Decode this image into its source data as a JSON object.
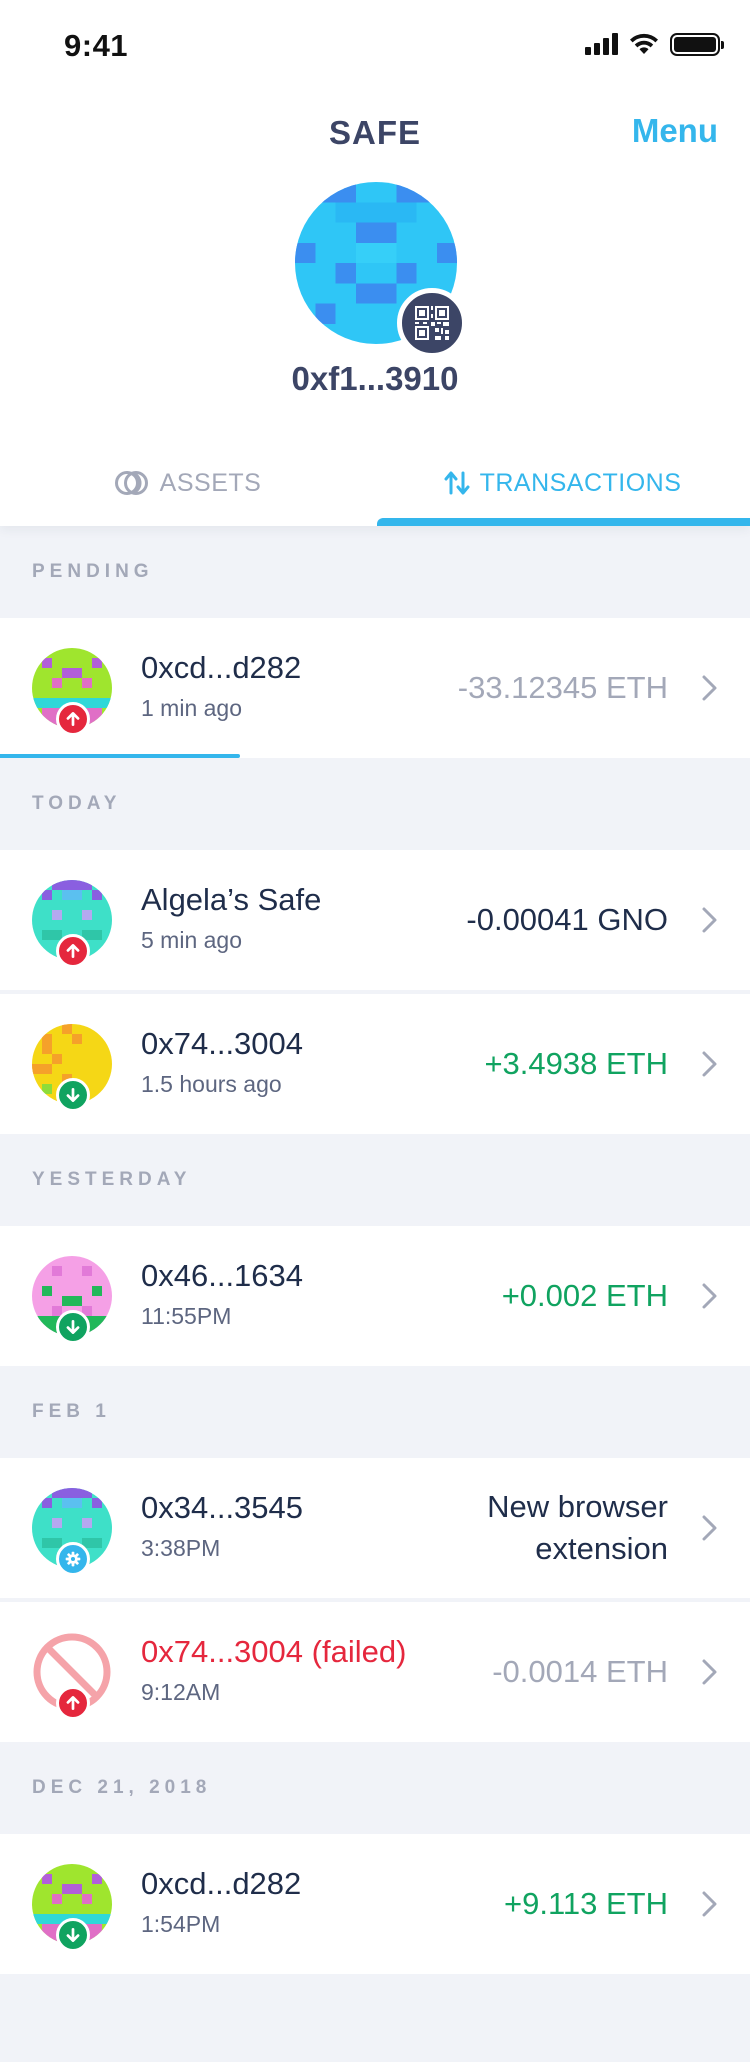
{
  "status_bar": {
    "time": "9:41"
  },
  "header": {
    "title": "SAFE",
    "menu_label": "Menu",
    "address": "0xf1...3910"
  },
  "tabs": [
    {
      "label": "ASSETS",
      "icon": "assets-icon",
      "active": false
    },
    {
      "label": "TRANSACTIONS",
      "icon": "transfer-arrows-icon",
      "active": true
    }
  ],
  "sections": {
    "pending": "PENDING",
    "today": "TODAY",
    "yesterday": "YESTERDAY",
    "feb1": "FEB 1",
    "dec21": "DEC 21, 2018"
  },
  "transactions": {
    "pending_1": {
      "name": "0xcd...d282",
      "time": "1 min ago",
      "amount": "-33.12345 ETH",
      "direction": "outgoing",
      "progress": 0.32
    },
    "today_1": {
      "name": "Algela’s Safe",
      "time": "5 min ago",
      "amount": "-0.00041 GNO",
      "direction": "outgoing"
    },
    "today_2": {
      "name": "0x74...3004",
      "time": "1.5 hours ago",
      "amount": "+3.4938 ETH",
      "direction": "incoming"
    },
    "yesterday_1": {
      "name": "0x46...1634",
      "time": "11:55PM",
      "amount": "+0.002 ETH",
      "direction": "incoming"
    },
    "feb1_1": {
      "name": "0x34...3545",
      "time": "3:38PM",
      "amount_line1": "New browser",
      "amount_line2": "extension",
      "direction": "settings"
    },
    "feb1_2": {
      "name": "0x74...3004 (failed)",
      "time": "9:12AM",
      "amount": "-0.0014 ETH",
      "direction": "outgoing",
      "status": "failed"
    },
    "dec21_1": {
      "name": "0xcd...d282",
      "time": "1:54PM",
      "amount": "+9.113 ETH",
      "direction": "incoming"
    }
  },
  "colors": {
    "accent": "#34b6ec",
    "outgoing": "#e5273d",
    "incoming": "#10a360",
    "muted": "#a3a8b8",
    "text": "#1f2d4a"
  }
}
